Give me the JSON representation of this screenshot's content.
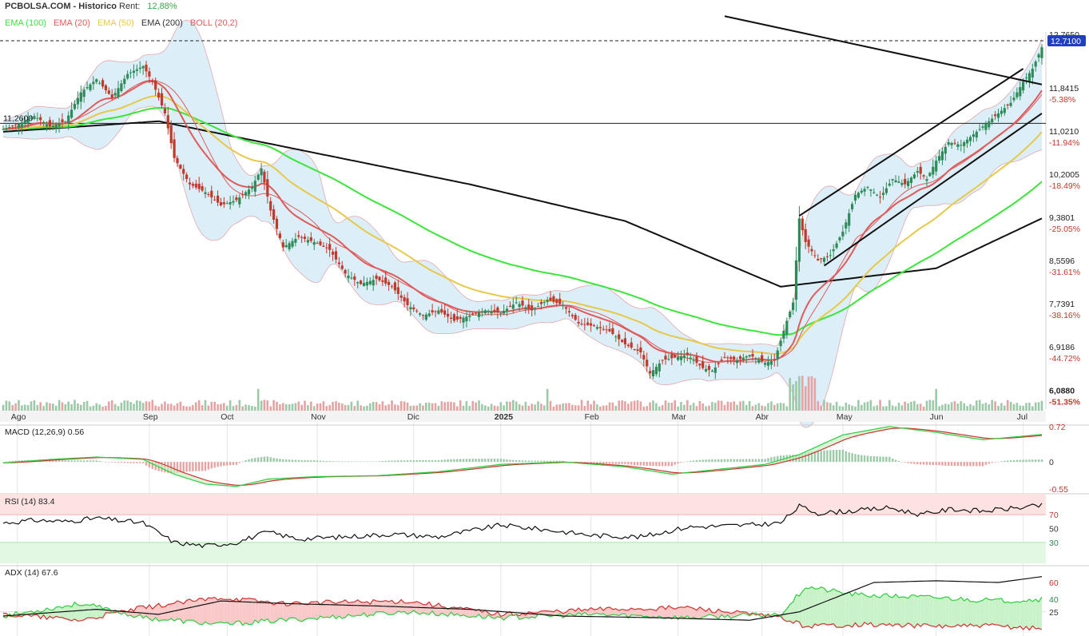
{
  "header": {
    "site": "PCBOLSA.COM - Historico",
    "rent_label": "Rent:",
    "rent_value": "12,88%"
  },
  "colors": {
    "up": "#2e8b57",
    "down": "#c0392b",
    "ema100": "#39e639",
    "ema20": "#e05a5a",
    "ema50": "#e8c84a",
    "ema200": "#111111",
    "boll_fill": "#d6ecf8",
    "current_price_bg": "#1f3fbf"
  },
  "chart_data": [
    {
      "type": "candlestick",
      "legend": [
        {
          "name": "EMA (100)",
          "color": "#39e639"
        },
        {
          "name": "EMA (20)",
          "color": "#e05a5a"
        },
        {
          "name": "EMA (50)",
          "color": "#e8c84a"
        },
        {
          "name": "EMA (200)",
          "color": "#333333"
        },
        {
          "name": "BOLL (20,2)",
          "color": "#e05a5a"
        }
      ],
      "x_ticks": [
        "Ago",
        "Sep",
        "Oct",
        "Nov",
        "Dic",
        "2025",
        "Feb",
        "Mar",
        "Abr",
        "May",
        "Jun",
        "Jul"
      ],
      "price_ticks": [
        {
          "price": 11.8415,
          "pct": "-5.38%"
        },
        {
          "price": 11.021,
          "pct": "-11.94%"
        },
        {
          "price": 10.2005,
          "pct": "-18.49%"
        },
        {
          "price": 9.3801,
          "pct": "-25.05%"
        },
        {
          "price": 8.5596,
          "pct": "-31.61%"
        },
        {
          "price": 7.7391,
          "pct": "-38.16%"
        },
        {
          "price": 6.9186,
          "pct": "-44.72%"
        },
        {
          "price": 6.088,
          "pct": "-51.35%"
        }
      ],
      "price_tick_labels": [
        "11,8415",
        "11,0210",
        "10,2005",
        "9,3801",
        "8,5596",
        "7,7391",
        "6,9186",
        "6,0880"
      ],
      "max_label": "12,7650",
      "current_price": "12,7100",
      "reference_line_label": "11,2600",
      "reference_line_value": 11.26,
      "ylim": [
        5.85,
        13.0
      ],
      "close_anchors": [
        [
          0,
          11.15
        ],
        [
          5,
          11.25
        ],
        [
          10,
          11.4
        ],
        [
          15,
          11.2
        ],
        [
          20,
          11.3
        ],
        [
          25,
          11.85
        ],
        [
          30,
          12.1
        ],
        [
          35,
          11.75
        ],
        [
          40,
          12.2
        ],
        [
          45,
          12.35
        ],
        [
          48,
          12.05
        ],
        [
          52,
          11.45
        ],
        [
          55,
          10.6
        ],
        [
          60,
          10.1
        ],
        [
          65,
          9.95
        ],
        [
          70,
          9.7
        ],
        [
          75,
          9.8
        ],
        [
          80,
          10.05
        ],
        [
          83,
          10.4
        ],
        [
          86,
          9.6
        ],
        [
          90,
          8.9
        ],
        [
          95,
          9.1
        ],
        [
          100,
          9.0
        ],
        [
          105,
          8.85
        ],
        [
          110,
          8.4
        ],
        [
          115,
          8.2
        ],
        [
          120,
          8.3
        ],
        [
          125,
          8.15
        ],
        [
          130,
          7.8
        ],
        [
          135,
          7.6
        ],
        [
          140,
          7.7
        ],
        [
          145,
          7.5
        ],
        [
          150,
          7.6
        ],
        [
          155,
          7.7
        ],
        [
          160,
          7.65
        ],
        [
          165,
          7.85
        ],
        [
          170,
          7.7
        ],
        [
          175,
          7.9
        ],
        [
          180,
          7.8
        ],
        [
          185,
          7.45
        ],
        [
          190,
          7.4
        ],
        [
          195,
          7.3
        ],
        [
          200,
          7.05
        ],
        [
          205,
          6.9
        ],
        [
          208,
          6.5
        ],
        [
          212,
          6.75
        ],
        [
          216,
          6.8
        ],
        [
          220,
          6.85
        ],
        [
          225,
          6.6
        ],
        [
          228,
          6.55
        ],
        [
          232,
          6.8
        ],
        [
          236,
          6.75
        ],
        [
          240,
          6.85
        ],
        [
          245,
          6.7
        ],
        [
          248,
          6.75
        ],
        [
          252,
          7.5
        ],
        [
          254,
          7.85
        ],
        [
          256,
          9.45
        ],
        [
          258,
          9.0
        ],
        [
          262,
          8.65
        ],
        [
          266,
          8.75
        ],
        [
          270,
          9.2
        ],
        [
          274,
          9.9
        ],
        [
          278,
          10.05
        ],
        [
          282,
          9.85
        ],
        [
          286,
          10.2
        ],
        [
          290,
          10.1
        ],
        [
          294,
          10.35
        ],
        [
          297,
          10.2
        ],
        [
          300,
          10.55
        ],
        [
          304,
          10.9
        ],
        [
          308,
          10.85
        ],
        [
          312,
          11.05
        ],
        [
          316,
          11.25
        ],
        [
          320,
          11.45
        ],
        [
          324,
          11.65
        ],
        [
          328,
          12.05
        ],
        [
          331,
          12.3
        ],
        [
          334,
          12.71
        ]
      ],
      "ema200_anchors": [
        [
          0,
          11.1
        ],
        [
          50,
          11.3
        ],
        [
          100,
          10.7
        ],
        [
          150,
          10.1
        ],
        [
          200,
          9.4
        ],
        [
          250,
          8.15
        ],
        [
          300,
          8.5
        ],
        [
          334,
          9.45
        ]
      ],
      "upper_channel": {
        "start": [
          256,
          9.5
        ],
        "end": [
          328,
          12.3
        ]
      },
      "lower_channel": {
        "start": [
          264,
          8.55
        ],
        "end": [
          334,
          11.45
        ]
      },
      "falling_line": {
        "start": [
          232,
          13.3
        ],
        "end": [
          334,
          12.0
        ]
      },
      "volume_ylim": [
        0,
        1.0
      ]
    },
    {
      "type": "line",
      "title": "MACD (12,26,9) 0.56",
      "y_ticks": [
        "0.72",
        "0",
        "-0.55"
      ],
      "ylim": [
        -0.6,
        0.75
      ],
      "macd_anchors": [
        [
          0,
          -0.02
        ],
        [
          15,
          0.05
        ],
        [
          30,
          0.1
        ],
        [
          45,
          0.05
        ],
        [
          55,
          -0.25
        ],
        [
          65,
          -0.45
        ],
        [
          75,
          -0.5
        ],
        [
          85,
          -0.35
        ],
        [
          100,
          -0.3
        ],
        [
          120,
          -0.28
        ],
        [
          140,
          -0.2
        ],
        [
          160,
          -0.05
        ],
        [
          180,
          0.0
        ],
        [
          200,
          -0.1
        ],
        [
          215,
          -0.25
        ],
        [
          230,
          -0.15
        ],
        [
          245,
          -0.05
        ],
        [
          256,
          0.15
        ],
        [
          270,
          0.55
        ],
        [
          285,
          0.72
        ],
        [
          300,
          0.6
        ],
        [
          315,
          0.45
        ],
        [
          334,
          0.56
        ]
      ]
    },
    {
      "type": "line",
      "title": "RSI (14) 83.4",
      "y_ticks": [
        "70",
        "50",
        "30"
      ],
      "ylim": [
        0,
        100
      ],
      "rsi_anchors": [
        [
          0,
          58
        ],
        [
          10,
          62
        ],
        [
          20,
          60
        ],
        [
          30,
          65
        ],
        [
          45,
          58
        ],
        [
          55,
          30
        ],
        [
          65,
          25
        ],
        [
          75,
          30
        ],
        [
          85,
          45
        ],
        [
          95,
          35
        ],
        [
          110,
          38
        ],
        [
          125,
          42
        ],
        [
          140,
          38
        ],
        [
          160,
          55
        ],
        [
          175,
          48
        ],
        [
          190,
          40
        ],
        [
          205,
          38
        ],
        [
          220,
          52
        ],
        [
          240,
          55
        ],
        [
          250,
          58
        ],
        [
          256,
          82
        ],
        [
          262,
          72
        ],
        [
          275,
          76
        ],
        [
          285,
          80
        ],
        [
          295,
          70
        ],
        [
          305,
          78
        ],
        [
          315,
          75
        ],
        [
          334,
          83
        ]
      ]
    },
    {
      "type": "line",
      "title": "ADX (14) 67.6",
      "y_ticks": [
        "60",
        "40",
        "25"
      ],
      "ylim": [
        0,
        80
      ],
      "adx_anchors": [
        [
          0,
          20
        ],
        [
          30,
          28
        ],
        [
          50,
          22
        ],
        [
          70,
          38
        ],
        [
          90,
          35
        ],
        [
          120,
          32
        ],
        [
          150,
          28
        ],
        [
          180,
          20
        ],
        [
          210,
          18
        ],
        [
          240,
          15
        ],
        [
          256,
          25
        ],
        [
          280,
          60
        ],
        [
          300,
          62
        ],
        [
          320,
          60
        ],
        [
          334,
          67
        ]
      ],
      "dip_anchors": [
        [
          0,
          20
        ],
        [
          25,
          35
        ],
        [
          45,
          18
        ],
        [
          70,
          10
        ],
        [
          90,
          15
        ],
        [
          130,
          25
        ],
        [
          160,
          18
        ],
        [
          190,
          22
        ],
        [
          220,
          18
        ],
        [
          250,
          22
        ],
        [
          258,
          55
        ],
        [
          275,
          45
        ],
        [
          300,
          42
        ],
        [
          320,
          38
        ],
        [
          334,
          40
        ]
      ],
      "dim_anchors": [
        [
          0,
          22
        ],
        [
          25,
          15
        ],
        [
          45,
          30
        ],
        [
          70,
          42
        ],
        [
          90,
          35
        ],
        [
          130,
          38
        ],
        [
          160,
          22
        ],
        [
          190,
          28
        ],
        [
          220,
          30
        ],
        [
          250,
          18
        ],
        [
          258,
          8
        ],
        [
          275,
          10
        ],
        [
          300,
          8
        ],
        [
          320,
          8
        ],
        [
          334,
          5
        ]
      ]
    }
  ]
}
